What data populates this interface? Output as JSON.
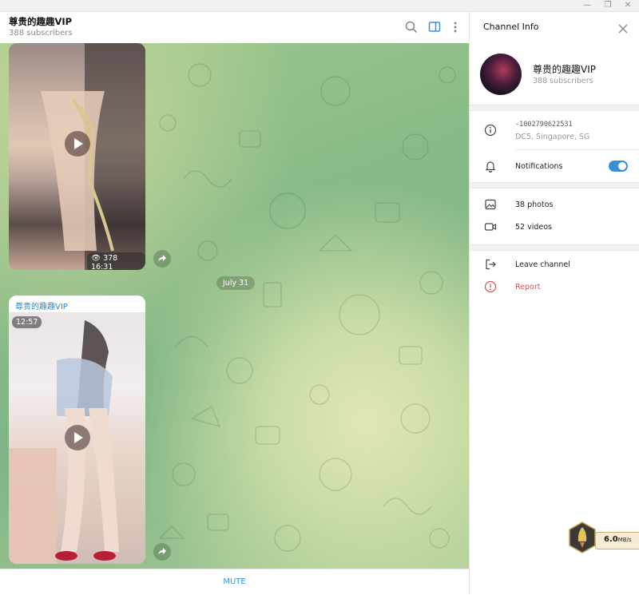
{
  "window": {
    "minimize": "—",
    "restore": "❐",
    "close": "✕"
  },
  "chat": {
    "title": "尊贵的趣趣VIP",
    "subtitle": "388 subscribers",
    "header_icons": [
      "search-icon",
      "sidebar-toggle-icon",
      "more-vertical-icon"
    ]
  },
  "messages": [
    {
      "type": "video",
      "views": "378",
      "duration": "16:31"
    },
    {
      "type": "video",
      "sender": "尊贵的趣趣VIP",
      "duration": "12:57"
    }
  ],
  "date_separator": "July 31",
  "bottom": {
    "mute_label": "MUTE"
  },
  "info_panel": {
    "title": "Channel Info",
    "channel_name": "尊贵的趣趣VIP",
    "subscribers": "388 subscribers",
    "channel_id": "-1002790622531",
    "dc_location": "DC5, Singapore, SG",
    "notifications_label": "Notifications",
    "notifications_on": true,
    "photos": "38 photos",
    "videos": "52 videos",
    "leave": "Leave channel",
    "report": "Report",
    "accent": "#3a8ed8",
    "danger": "#d9534f"
  },
  "speed_widget": {
    "value": "6.0",
    "unit": "MB/s"
  }
}
